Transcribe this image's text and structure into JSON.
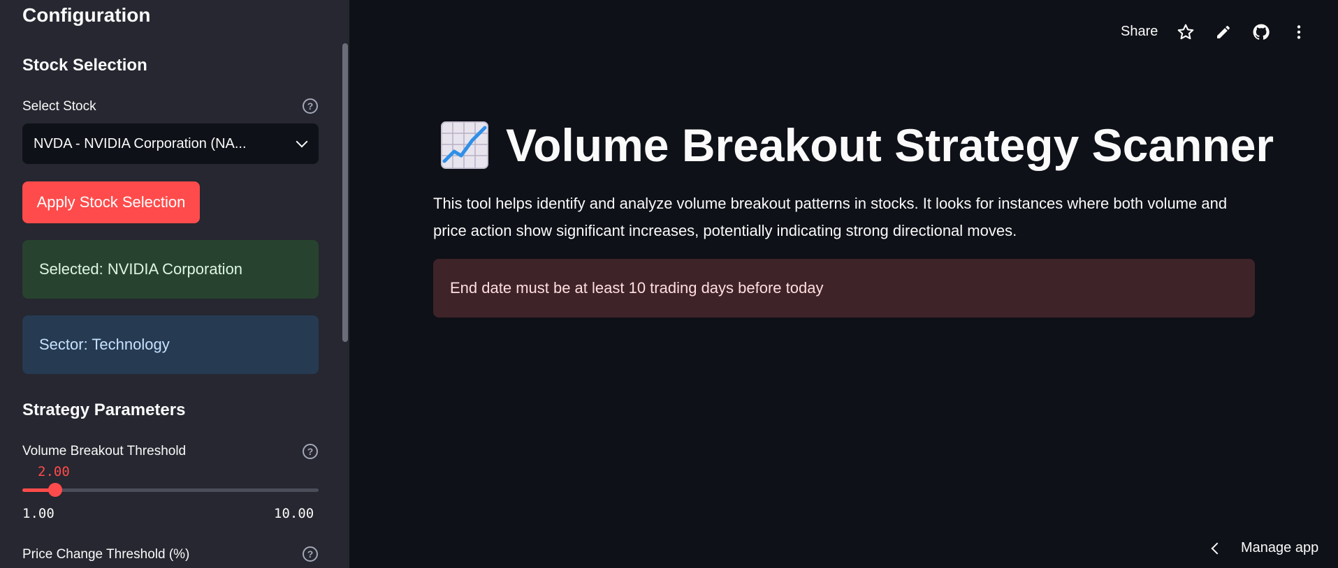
{
  "sidebar": {
    "title": "Configuration",
    "stock_section": {
      "heading": "Stock Selection",
      "select_label": "Select Stock",
      "selected_value": "NVDA - NVIDIA Corporation (NA...",
      "apply_button": "Apply Stock Selection",
      "selected_alert": "Selected: NVIDIA Corporation",
      "sector_alert": "Sector: Technology"
    },
    "strategy_section": {
      "heading": "Strategy Parameters",
      "volume_threshold": {
        "label": "Volume Breakout Threshold",
        "value": "2.00",
        "min": "1.00",
        "max": "10.00",
        "fraction": 0.111
      },
      "price_change_label": "Price Change Threshold (%)"
    }
  },
  "header": {
    "share_label": "Share",
    "icons": [
      "star-icon",
      "edit-icon",
      "github-icon",
      "more-menu-icon"
    ]
  },
  "main": {
    "title_emoji": "chart-increasing-icon",
    "title": "Volume Breakout Strategy Scanner",
    "intro": "This tool helps identify and analyze volume breakout patterns in stocks. It looks for instances where both volume and price action show significant increases, potentially indicating strong directional moves.",
    "error_message": "End date must be at least 10 trading days before today"
  },
  "footer": {
    "manage_app_label": "Manage app"
  },
  "colors": {
    "accent": "#ff4b4b",
    "sidebar_bg": "#262730",
    "main_bg": "#0e1117",
    "success_bg": "#27432f",
    "info_bg": "#263a52",
    "error_bg": "#3e2329"
  }
}
